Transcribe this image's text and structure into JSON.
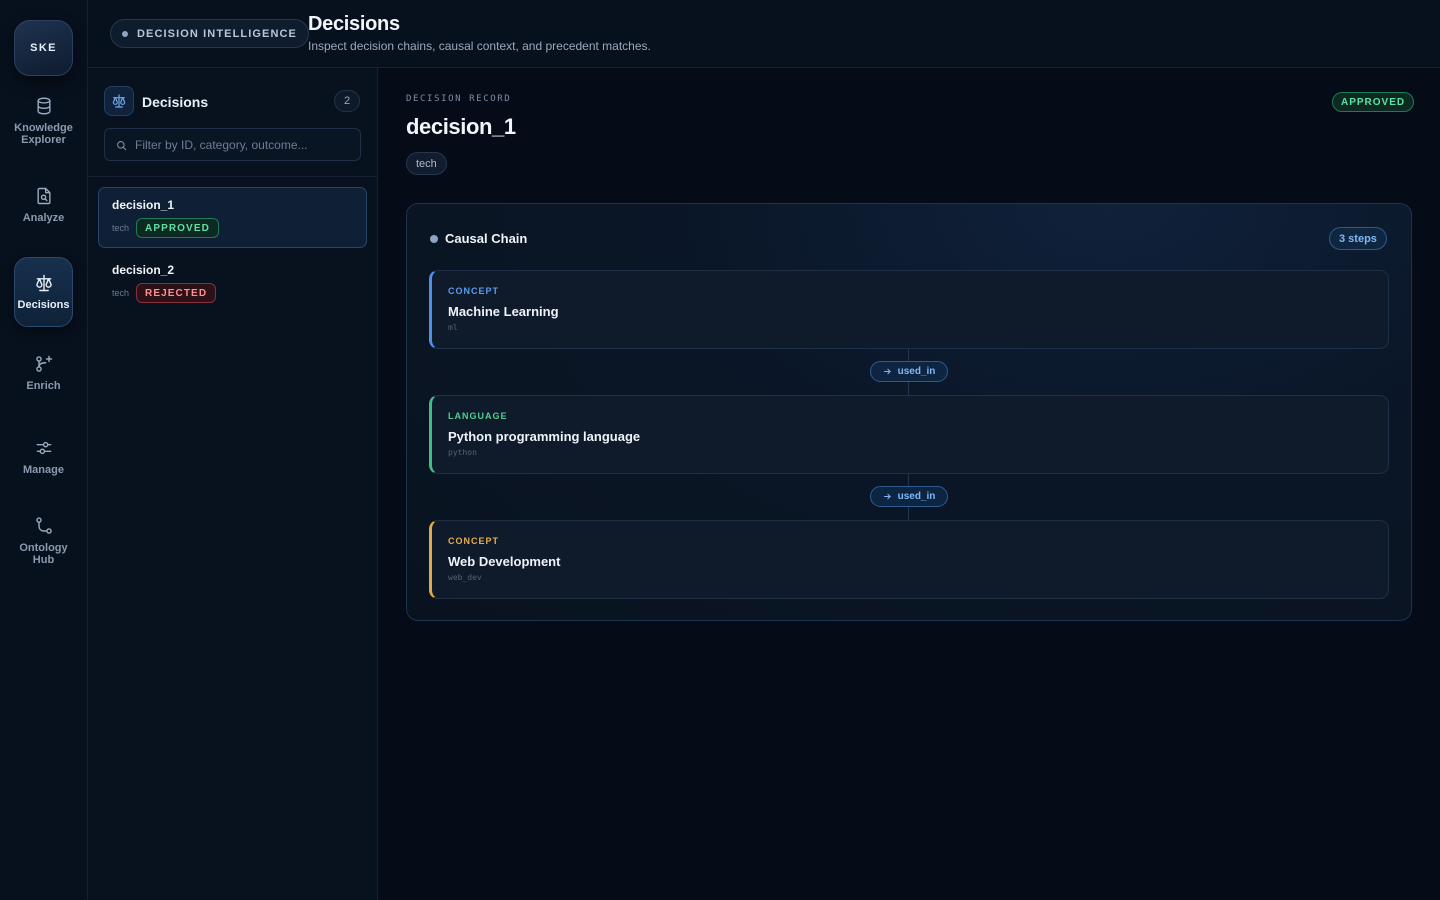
{
  "rail": {
    "logo": "SKE",
    "items": [
      {
        "label": "Knowledge Explorer",
        "icon": "database-icon"
      },
      {
        "label": "Analyze",
        "icon": "file-search-icon"
      },
      {
        "label": "Decisions",
        "icon": "scale-icon",
        "active": true
      },
      {
        "label": "Enrich",
        "icon": "git-merge-plus-icon"
      },
      {
        "label": "Manage",
        "icon": "sliders-icon"
      },
      {
        "label": "Ontology Hub",
        "icon": "git-branch-icon"
      }
    ]
  },
  "header": {
    "chip": "DECISION INTELLIGENCE",
    "title": "Decisions",
    "subtitle": "Inspect decision chains, causal context, and precedent matches."
  },
  "list": {
    "title": "Decisions",
    "count": "2",
    "search_placeholder": "Filter by ID, category, outcome...",
    "items": [
      {
        "name": "decision_1",
        "category": "tech",
        "status": "APPROVED"
      },
      {
        "name": "decision_2",
        "category": "tech",
        "status": "REJECTED"
      }
    ]
  },
  "detail": {
    "label": "DECISION RECORD",
    "title": "decision_1",
    "status": "APPROVED",
    "tag": "tech",
    "chain": {
      "title": "Causal Chain",
      "steps_label": "3 steps",
      "nodes": [
        {
          "type": "CONCEPT",
          "name": "Machine Learning",
          "id": "ml",
          "color": "#4f8fe8"
        },
        {
          "type": "LANGUAGE",
          "name": "Python programming language",
          "id": "python",
          "color": "#3fbf7f"
        },
        {
          "type": "CONCEPT",
          "name": "Web Development",
          "id": "web_dev",
          "color": "#e2a94a"
        }
      ],
      "edges": [
        {
          "label": "used_in"
        },
        {
          "label": "used_in"
        }
      ]
    }
  },
  "colors": {
    "background": "#060c17",
    "approved": "#5fe0a4",
    "rejected": "#ff8f98",
    "accent": "#7fb8f4"
  }
}
